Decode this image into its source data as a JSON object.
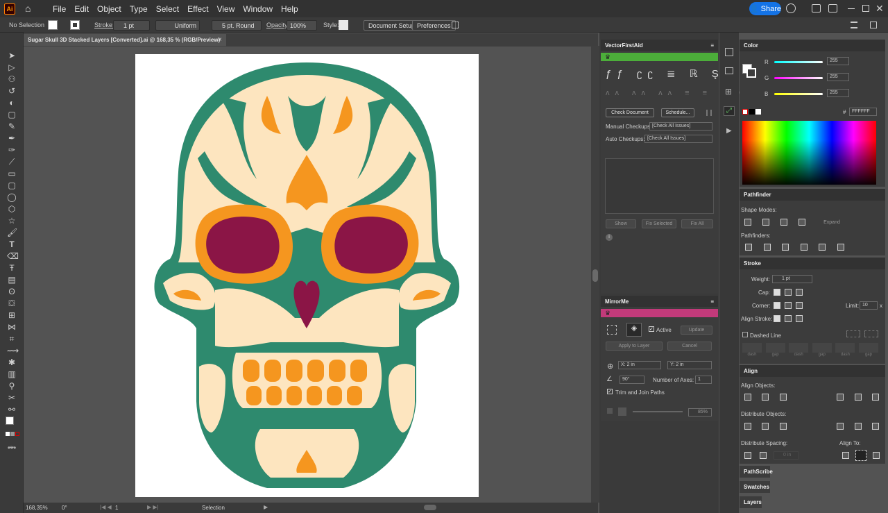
{
  "app": {
    "logo": "Ai",
    "share_label": "Share"
  },
  "menu": [
    "File",
    "Edit",
    "Object",
    "Type",
    "Select",
    "Effect",
    "View",
    "Window",
    "Help"
  ],
  "control_bar": {
    "selection": "No Selection",
    "stroke_label": "Stroke:",
    "stroke_weight": "1 pt",
    "stroke_profile": "Uniform",
    "brush": "5 pt. Round",
    "opacity_label": "Opacity:",
    "opacity": "100%",
    "style_label": "Style:",
    "document_setup": "Document Setup",
    "preferences": "Preferences"
  },
  "document_tab": {
    "title": "Sugar Skull 3D Stacked Layers [Converted].ai @ 168,35 % (RGB/Preview)",
    "close": "×"
  },
  "status_bar": {
    "zoom": "168,35%",
    "rotation": "0°",
    "artboard": "1",
    "tool": "Selection"
  },
  "vectorfirstaid": {
    "title": "VectorFirstAid",
    "check_document": "Check Document",
    "schedule": "Schedule...",
    "manual_label": "Manual Checkups:",
    "manual_value": "[Check All Issues]",
    "auto_label": "Auto Checkups:",
    "auto_value": "[Check All Issues]",
    "show": "Show",
    "fix_selected": "Fix Selected",
    "fix_all": "Fix All",
    "info_glyph": "i",
    "accent": "#4cae3a"
  },
  "mirrorme": {
    "title": "MirrorMe",
    "active_label": "Active",
    "update": "Update",
    "apply_to_layer": "Apply to Layer",
    "cancel": "Cancel",
    "x_label": "X:",
    "x_value": "2 in",
    "y_label": "Y:",
    "y_value": "2 in",
    "angle": "90°",
    "axes_label": "Number of Axes:",
    "axes_value": "1",
    "trim_label": "Trim and Join Paths",
    "opacity": "85%",
    "accent": "#c23a7a"
  },
  "color_panel": {
    "title": "Color",
    "r_label": "R",
    "r_value": "255",
    "g_label": "G",
    "g_value": "255",
    "b_label": "B",
    "b_value": "255",
    "hex_label": "#",
    "hex_value": "FFFFFF"
  },
  "pathfinder": {
    "title": "Pathfinder",
    "shape_modes": "Shape Modes:",
    "pathfinders": "Pathfinders:",
    "expand": "Expand"
  },
  "stroke_panel": {
    "title": "Stroke",
    "weight_label": "Weight:",
    "weight_value": "1 pt",
    "cap_label": "Cap:",
    "corner_label": "Corner:",
    "limit_label": "Limit:",
    "limit_value": "10",
    "limit_unit": "x",
    "align_label": "Align Stroke:",
    "dashed_label": "Dashed Line",
    "dash_labels": [
      "dash",
      "gap",
      "dash",
      "gap",
      "dash",
      "gap"
    ]
  },
  "align_panel": {
    "title": "Align",
    "align_objects": "Align Objects:",
    "distribute_objects": "Distribute Objects:",
    "distribute_spacing": "Distribute Spacing:",
    "align_to": "Align To:",
    "spacing_value": "0 in"
  },
  "collapsed_panels": [
    "PathScribe",
    "Swatches",
    "Layers"
  ],
  "colors": {
    "teal": "#2e8a6e",
    "cream": "#fde5bf",
    "orange": "#f5961f",
    "magenta": "#8b1546"
  }
}
